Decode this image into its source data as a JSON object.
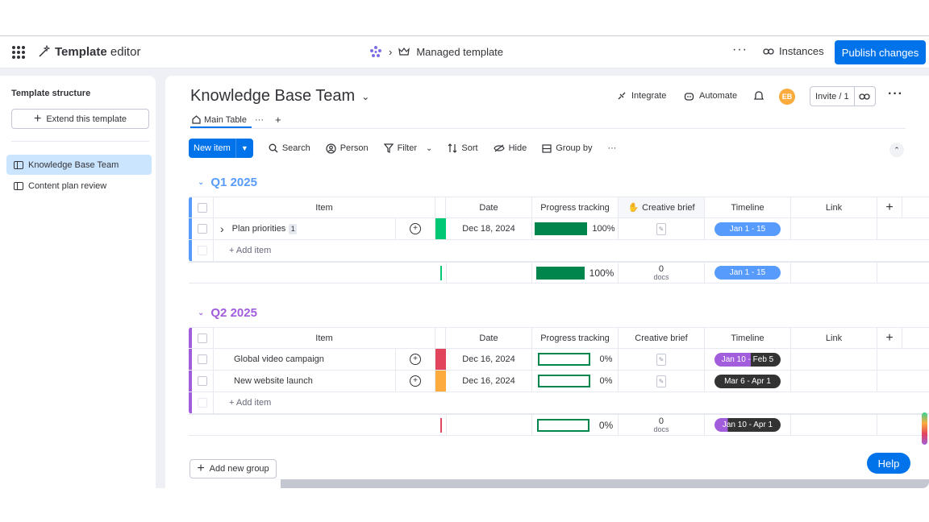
{
  "topbar": {
    "title_bold": "Template",
    "title_rest": " editor",
    "breadcrumb_current": "Managed template",
    "more": "···",
    "instances_label": "Instances",
    "publish_label": "Publish changes"
  },
  "left_panel": {
    "title": "Template structure",
    "extend_label": "Extend this template",
    "items": [
      {
        "label": "Knowledge Base Team",
        "active": true
      },
      {
        "label": "Content plan review",
        "active": false
      }
    ]
  },
  "board": {
    "title": "Knowledge Base Team",
    "actions": {
      "integrate": "Integrate",
      "automate": "Automate"
    },
    "avatar_initials": "EB",
    "invite_label": "Invite / 1",
    "tabs": {
      "main": "Main Table",
      "more": "···",
      "add": "+"
    },
    "toolbar": {
      "new_item": "New item",
      "search": "Search",
      "person": "Person",
      "filter": "Filter",
      "sort": "Sort",
      "hide": "Hide",
      "group_by": "Group by",
      "more": "···"
    },
    "columns": {
      "item": "Item",
      "date": "Date",
      "progress": "Progress tracking",
      "brief": "Creative brief",
      "timeline": "Timeline",
      "link": "Link",
      "add": "+"
    },
    "add_item_label": "+ Add item",
    "docs_label": "docs",
    "add_group_label": "Add new group",
    "help_label": "Help"
  },
  "groups": [
    {
      "title": "Q1 2025",
      "color": "#579bfc",
      "rows": [
        {
          "name": "Plan priorities",
          "subitems": "1",
          "status_color": "#00c875",
          "date": "Dec 18, 2024",
          "progress": 100,
          "progress_label": "100%",
          "timeline": "Jan 1 - 15",
          "timeline_color": "#579bfc"
        }
      ],
      "summary": {
        "progress": 100,
        "progress_label": "100%",
        "docs": "0",
        "timeline": "Jan 1 - 15",
        "timeline_color": "#579bfc",
        "marker_color": "#00c875"
      }
    },
    {
      "title": "Q2 2025",
      "color": "#a25ddc",
      "rows": [
        {
          "name": "Global video campaign",
          "status_color": "#e2445c",
          "date": "Dec 16, 2024",
          "progress": 0,
          "progress_label": "0%",
          "timeline": "Jan 10 - Feb 5",
          "timeline_color": "#a25ddc"
        },
        {
          "name": "New website launch",
          "status_color": "#fdab3d",
          "date": "Dec 16, 2024",
          "progress": 0,
          "progress_label": "0%",
          "timeline": "Mar 6 - Apr 1",
          "timeline_color": "#333333"
        }
      ],
      "summary": {
        "progress": 0,
        "progress_label": "0%",
        "docs": "0",
        "timeline": "Jan 10 - Apr 1",
        "timeline_color": "#a25ddc",
        "marker_color": "#e2445c"
      }
    }
  ]
}
